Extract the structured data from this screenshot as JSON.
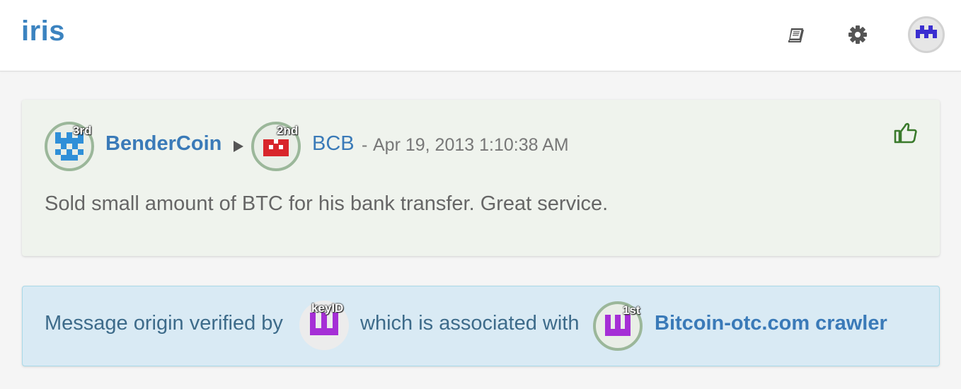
{
  "header": {
    "brand": "iris",
    "icons": [
      "book-icon",
      "gear-icon",
      "user-avatar-identicon"
    ]
  },
  "message": {
    "author": {
      "name": "BenderCoin",
      "rank": "3rd"
    },
    "recipient": {
      "name": "BCB",
      "rank": "2nd"
    },
    "separator": "-",
    "timestamp": "Apr 19, 2013 1:10:38 AM",
    "text": "Sold small amount of BTC for his bank transfer. Great service.",
    "rating_icon": "thumbs-up-icon"
  },
  "verification": {
    "prefix": "Message origin verified by",
    "key_label": "keyID",
    "middle": "which is associated with",
    "verifier": {
      "name": "Bitcoin-otc.com crawler",
      "rank": "1st"
    }
  },
  "colors": {
    "brand": "#3b83c0",
    "link": "#3a7ab8",
    "positive": "#3a7a2c",
    "card_bg": "#eff3ed",
    "info_bg": "#d9eaf4"
  }
}
